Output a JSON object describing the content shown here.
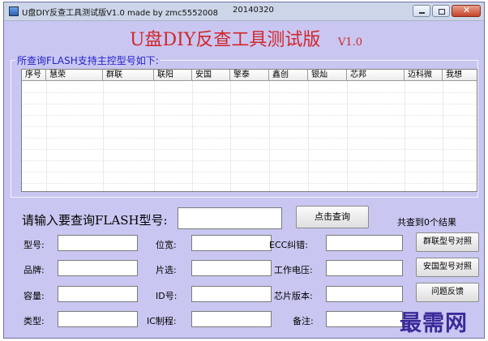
{
  "window": {
    "title": "U盘DIY反查工具测试版V1.0  made by zmc5552008",
    "date": "20140320"
  },
  "app": {
    "title": "U盘DIY反查工具测试版",
    "version": "V1.0"
  },
  "group_label": "所查询FLASH支持主控型号如下:",
  "list_columns": [
    "序号",
    "慧荣",
    "群联",
    "联阳",
    "安国",
    "擎泰",
    "鑫创",
    "银灿",
    "芯邦",
    "迈科微",
    "我想"
  ],
  "query": {
    "label": "请输入要查询FLASH型号:",
    "value": "",
    "button": "点击查询",
    "result": "共查到0个结果"
  },
  "fields": {
    "model": {
      "label": "型号:",
      "value": ""
    },
    "brand": {
      "label": "品牌:",
      "value": ""
    },
    "capacity": {
      "label": "容量:",
      "value": ""
    },
    "type": {
      "label": "类型:",
      "value": ""
    },
    "bit_width": {
      "label": "位宽:",
      "value": ""
    },
    "chip_select": {
      "label": "片选:",
      "value": ""
    },
    "id": {
      "label": "ID号:",
      "value": ""
    },
    "ic_process": {
      "label": "IC制程:",
      "value": ""
    },
    "ecc": {
      "label": "ECC纠错:",
      "value": ""
    },
    "voltage": {
      "label": "工作电压:",
      "value": ""
    },
    "chip_version": {
      "label": "芯片版本:",
      "value": ""
    },
    "remark": {
      "label": "备注:",
      "value": ""
    }
  },
  "buttons": {
    "phison": "群联型号对照",
    "alcor": "安国型号对照",
    "feedback": "问题反馈"
  },
  "watermark": "最需网"
}
